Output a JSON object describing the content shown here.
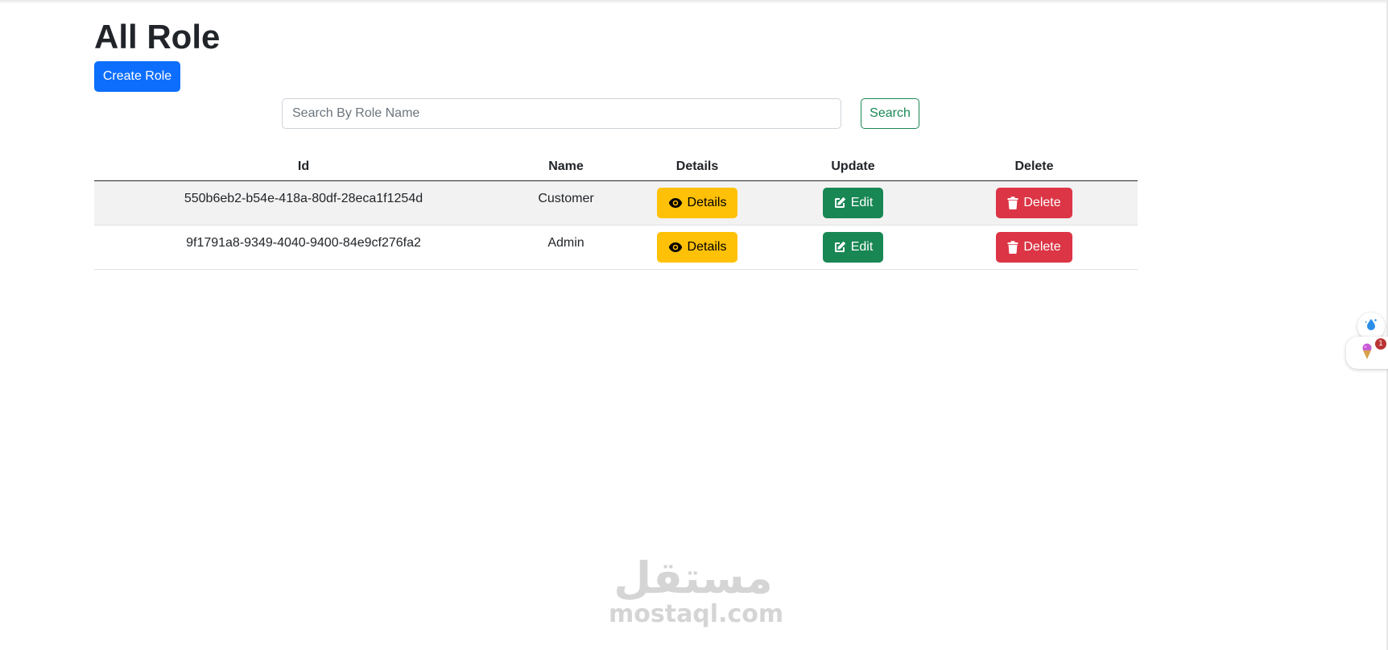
{
  "page": {
    "title": "All Role"
  },
  "toolbar": {
    "create_label": "Create Role"
  },
  "search": {
    "placeholder": "Search By Role Name",
    "value": "",
    "button_label": "Search"
  },
  "table": {
    "headers": {
      "id": "Id",
      "name": "Name",
      "details": "Details",
      "update": "Update",
      "delete": "Delete"
    },
    "rows": [
      {
        "id": "550b6eb2-b54e-418a-80df-28eca1f1254d",
        "name": "Customer",
        "details_label": "Details",
        "edit_label": "Edit",
        "delete_label": "Delete"
      },
      {
        "id": "9f1791a8-9349-4040-9400-84e9cf276fa2",
        "name": "Admin",
        "details_label": "Details",
        "edit_label": "Edit",
        "delete_label": "Delete"
      }
    ]
  },
  "watermark": {
    "arabic": "مستقل",
    "latin": "mostaql.com"
  },
  "side_widget": {
    "badge": "1",
    "icons": [
      "water-drop-icon",
      "ice-cream-icon"
    ]
  },
  "colors": {
    "primary": "#0d6efd",
    "success": "#198754",
    "warning": "#ffc107",
    "danger": "#dc3545"
  }
}
